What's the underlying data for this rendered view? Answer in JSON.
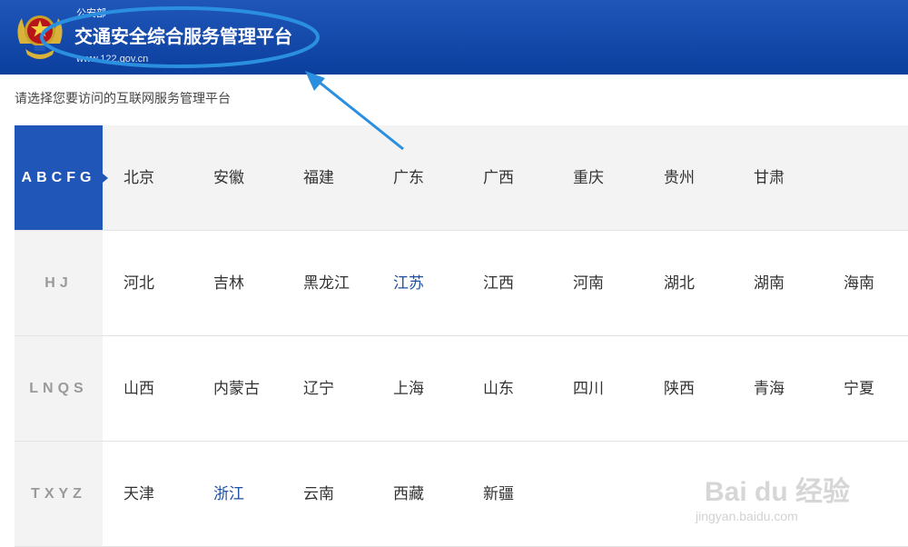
{
  "header": {
    "ministry": "公安部",
    "title": "交通安全综合服务管理平台",
    "url": "www.122.gov.cn",
    "emblem_icon": "police-emblem-icon"
  },
  "prompt": "请选择您要访问的互联网服务管理平台",
  "groups": [
    {
      "label": "ABCFG",
      "active": true,
      "provinces": [
        "北京",
        "安徽",
        "福建",
        "广东",
        "广西",
        "重庆",
        "贵州",
        "甘肃"
      ]
    },
    {
      "label": "HJ",
      "active": false,
      "provinces": [
        "河北",
        "吉林",
        "黑龙江",
        "江苏",
        "江西",
        "河南",
        "湖北",
        "湖南",
        "海南"
      ]
    },
    {
      "label": "LNQS",
      "active": false,
      "provinces": [
        "山西",
        "内蒙古",
        "辽宁",
        "上海",
        "山东",
        "四川",
        "陕西",
        "青海",
        "宁夏"
      ]
    },
    {
      "label": "TXYZ",
      "active": false,
      "provinces": [
        "天津",
        "浙江",
        "云南",
        "西藏",
        "新疆"
      ]
    }
  ],
  "highlighted_provinces": [
    "江苏",
    "浙江"
  ],
  "watermark": {
    "text": "Bai du 经验",
    "url": "jingyan.baidu.com"
  },
  "colors": {
    "header_blue": "#1f56b8",
    "annotation_blue": "#2b8fe0",
    "highlight_text": "#1f4fa0"
  }
}
